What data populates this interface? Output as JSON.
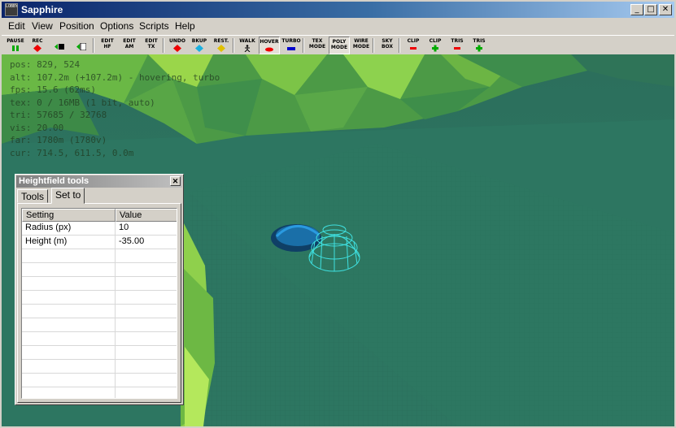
{
  "window": {
    "title": "Sapphire",
    "icon_text": "LOBBY",
    "min": "_",
    "max": "□",
    "close": "✕"
  },
  "menu": [
    "Edit",
    "View",
    "Position",
    "Options",
    "Scripts",
    "Help"
  ],
  "toolbar": [
    {
      "label": "PAUSE",
      "icon": "pause-icon",
      "color": "#0a0"
    },
    {
      "label": "REC",
      "icon": "record-icon",
      "color": "#e00"
    },
    {
      "label": "",
      "icon": "save-icon",
      "color": "#0a0"
    },
    {
      "label": "",
      "icon": "load-icon",
      "color": "#0a0"
    },
    {
      "label": "EDIT\nHF",
      "icon": "",
      "color": "",
      "pressed": false
    },
    {
      "label": "EDIT\nAM",
      "icon": "",
      "color": ""
    },
    {
      "label": "EDIT\nTX",
      "icon": "",
      "color": ""
    },
    {
      "label": "UNDO",
      "icon": "undo-icon",
      "color": "#e00"
    },
    {
      "label": "BKUP",
      "icon": "backup-icon",
      "color": "#1ab0e0"
    },
    {
      "label": "REST.",
      "icon": "restore-icon",
      "color": "#e0c000"
    },
    {
      "label": "WALK",
      "icon": "walk-icon",
      "color": "#000"
    },
    {
      "label": "HOVER",
      "icon": "hover-icon",
      "color": "#e00",
      "pressed": true
    },
    {
      "label": "TURBO",
      "icon": "turbo-icon",
      "color": "#00c"
    },
    {
      "label": "TEX\nMODE",
      "icon": "",
      "color": ""
    },
    {
      "label": "POLY\nMODE",
      "icon": "",
      "color": "",
      "pressed": true
    },
    {
      "label": "WIRE\nMODE",
      "icon": "",
      "color": ""
    },
    {
      "label": "SKY\nBOX",
      "icon": "",
      "color": ""
    },
    {
      "label": "CLIP",
      "icon": "clip-minus-icon",
      "color": "#e00"
    },
    {
      "label": "CLIP",
      "icon": "clip-plus-icon",
      "color": "#0a0"
    },
    {
      "label": "TRIS",
      "icon": "tris-minus-icon",
      "color": "#e00"
    },
    {
      "label": "TRIS",
      "icon": "tris-plus-icon",
      "color": "#0a0"
    }
  ],
  "hud": [
    "pos: 829, 524",
    "alt: 107.2m (+107.2m) - hovering, turbo",
    "fps: 15.6 (62ms)",
    "tex: 0 / 16MB (1 bit, auto)",
    "tri: 57685 / 32768",
    "vis: 20.00",
    "far: 1780m (1780v)",
    "cur: 714.5, 611.5, 0.0m"
  ],
  "panel": {
    "title": "Heightfield tools",
    "close": "✕",
    "tabs": [
      "Tools",
      "Set to"
    ],
    "active_tab": "Set to",
    "columns": [
      "Setting",
      "Value"
    ],
    "rows": [
      {
        "setting": "Radius (px)",
        "value": "10"
      },
      {
        "setting": "Height (m)",
        "value": "-35.00"
      }
    ]
  },
  "colors": {
    "terrain_light": "#9ad64a",
    "terrain_dark": "#3e8e4a",
    "ground": "#2e7a62",
    "crater": "#1a6fa8",
    "brush": "#3fe0e0"
  }
}
